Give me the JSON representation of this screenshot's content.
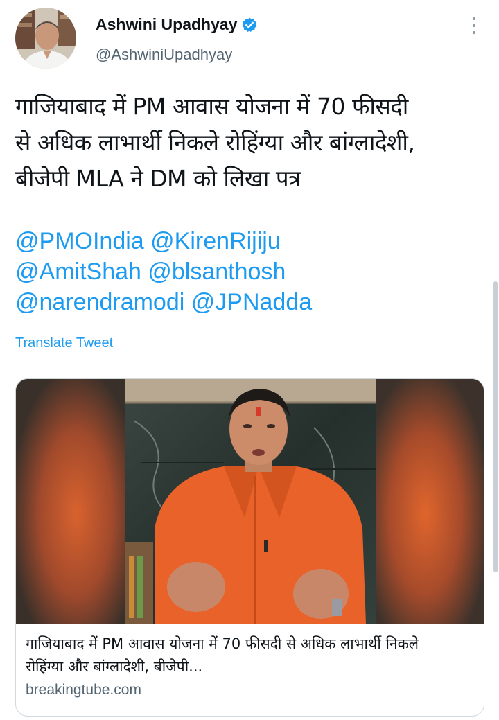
{
  "author": {
    "display_name": "Ashwini Upadhyay",
    "handle": "@AshwiniUpadhyay",
    "verified": true
  },
  "tweet": {
    "text_lines": [
      "गाजियाबाद में PM आवास योजना में 70 फीसदी",
      "से अधिक लाभार्थी निकले रोहिंग्या और बांग्लादेशी,",
      "बीजेपी MLA ने DM को लिखा पत्र"
    ],
    "mention_rows": [
      [
        "@PMOIndia",
        "@KirenRijiju"
      ],
      [
        "@AmitShah",
        "@blsanthosh"
      ],
      [
        "@narendramodi",
        "@JPNadda"
      ]
    ],
    "translate_label": "Translate Tweet"
  },
  "link_card": {
    "title_lines": [
      "गाजियाबाद में PM आवास योजना में 70 फीसदी से अधिक लाभार्थी निकले",
      "रोहिंग्या और बांग्लादेशी, बीजेपी..."
    ],
    "domain": "breakingtube.com"
  },
  "icons": {
    "verified": "verified-badge-icon",
    "more": "more-options-icon"
  },
  "colors": {
    "accent": "#1d9bf0",
    "text": "#0f1419",
    "muted": "#536471",
    "border": "#cfd9de",
    "shirt": "#e8622a"
  }
}
